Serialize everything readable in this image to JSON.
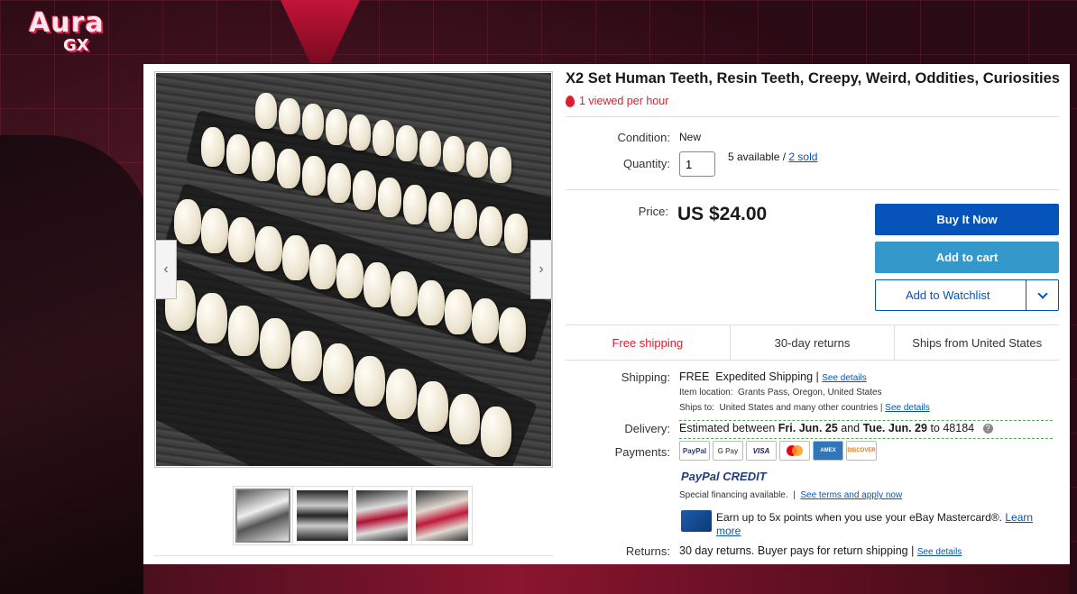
{
  "wallpaper": {
    "logo_line1": "Aura",
    "logo_line2": "GX",
    "accent": "#e0204a"
  },
  "listing": {
    "title": "X2 Set Human Teeth, Resin Teeth, Creepy, Weird, Oddities, Curiosities",
    "hot_text": "1 viewed per hour",
    "condition_label": "Condition:",
    "condition_value": "New",
    "quantity_label": "Quantity:",
    "quantity_value": "1",
    "available_text": "5 available /",
    "sold_text": "2 sold",
    "price_label": "Price:",
    "price_value": "US $24.00",
    "buy_now": "Buy It Now",
    "add_to_cart": "Add to cart",
    "add_to_watchlist": "Add to Watchlist"
  },
  "shipping_tabs": [
    "Free shipping",
    "30-day returns",
    "Ships from United States"
  ],
  "shipping": {
    "label": "Shipping:",
    "free": "FREE",
    "method": "Expedited Shipping |",
    "see_details": "See details",
    "location_label": "Item location:",
    "location_value": "Grants Pass, Oregon, United States",
    "ships_to_label": "Ships to:",
    "ships_to_value": "United States and many other countries |",
    "ships_to_link": "See details"
  },
  "delivery": {
    "label": "Delivery:",
    "text_prefix": "Estimated between",
    "date1": "Fri. Jun. 25",
    "and": "and",
    "date2": "Tue. Jun. 29",
    "to": "to 48184"
  },
  "payments": {
    "label": "Payments:",
    "methods": [
      "PayPal",
      "G Pay",
      "VISA",
      "MC",
      "AMEX",
      "DISCOVER"
    ],
    "paypal_credit": "PayPal CREDIT",
    "financing": "Special financing available.",
    "financing_link": "See terms and apply now",
    "mc_text": "Earn up to 5x points when you use your eBay Mastercard®.",
    "mc_link": "Learn more"
  },
  "returns": {
    "label": "Returns:",
    "text": "30 day returns. Buyer pays for return shipping |",
    "link": "See details"
  },
  "colors": {
    "ebay_blue": "#0654ba",
    "cart_blue": "#3498ca",
    "hot_red": "#dd1e31"
  }
}
